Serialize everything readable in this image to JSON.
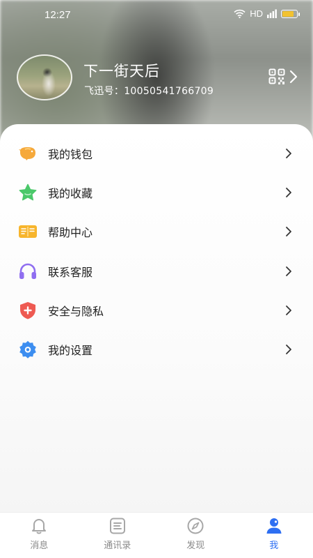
{
  "status": {
    "time": "12:27",
    "network": "HD"
  },
  "profile": {
    "nickname": "下一街天后",
    "fx_id": "飞迅号：10050541766709"
  },
  "menu": [
    {
      "label": "我的钱包",
      "icon": "wallet-icon",
      "color": "#f6a93b"
    },
    {
      "label": "我的收藏",
      "icon": "star-icon",
      "color": "#4bc86a"
    },
    {
      "label": "帮助中心",
      "icon": "help-book-icon",
      "color": "#f7b52c"
    },
    {
      "label": "联系客服",
      "icon": "headphones-icon",
      "color": "#8f6ef0"
    },
    {
      "label": "安全与隐私",
      "icon": "shield-icon",
      "color": "#ee5a52"
    },
    {
      "label": "我的设置",
      "icon": "gear-icon",
      "color": "#3d8ef0"
    }
  ],
  "tabs": [
    {
      "label": "消息",
      "icon": "bell-icon",
      "active": false
    },
    {
      "label": "通讯录",
      "icon": "contacts-icon",
      "active": false
    },
    {
      "label": "发现",
      "icon": "compass-icon",
      "active": false
    },
    {
      "label": "我",
      "icon": "user-icon",
      "active": true
    }
  ],
  "colors": {
    "accent": "#2e6ff2",
    "inactive": "#8a8a8a"
  }
}
